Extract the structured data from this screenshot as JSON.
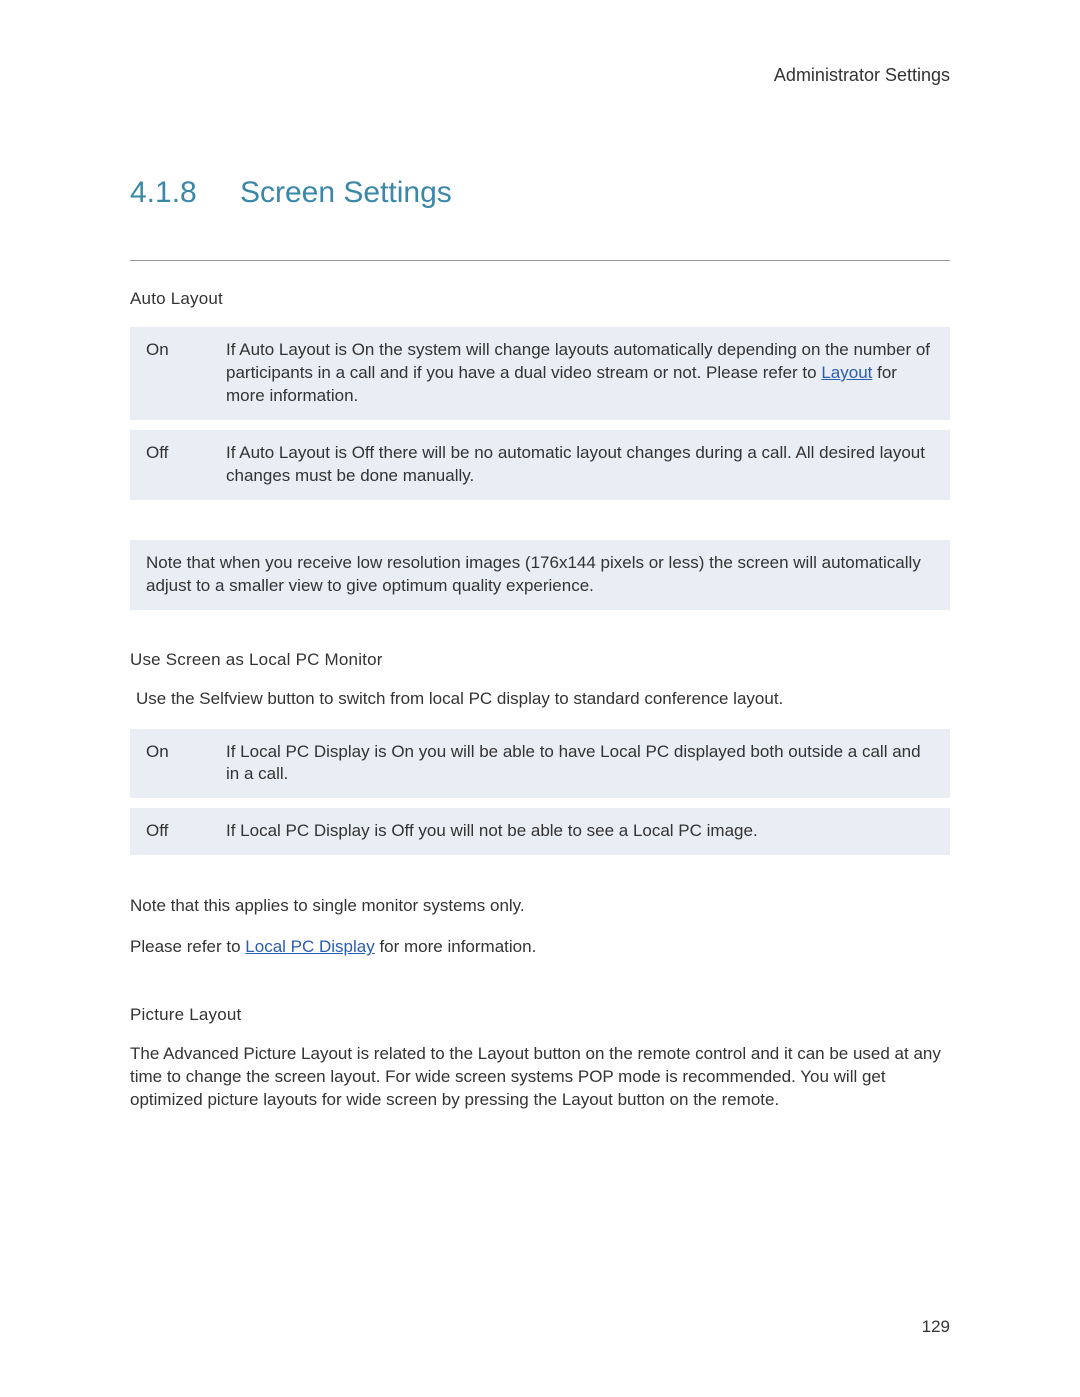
{
  "header": {
    "breadcrumb": "Administrator Settings"
  },
  "section": {
    "number": "4.1.8",
    "title": "Screen Settings"
  },
  "auto_layout": {
    "heading": "Auto Layout",
    "rows": [
      {
        "key": "On",
        "desc_before_link": "If Auto Layout is On the system will change layouts automatically depending on the number of participants in a call and if you have a dual video stream or not. Please refer to ",
        "link_text": "Layout",
        "desc_after_link": " for more information."
      },
      {
        "key": "Off",
        "desc": "If Auto Layout is Off there will be no automatic layout changes during a call. All desired layout changes must be done manually."
      }
    ],
    "note": "Note that when you receive low resolution images (176x144 pixels or less) the screen will automatically adjust to a smaller view to give optimum quality experience."
  },
  "local_pc": {
    "heading": "Use Screen as Local PC Monitor",
    "intro": "Use the Selfview button to switch from local PC display to standard conference layout.",
    "rows": [
      {
        "key": "On",
        "desc": "If Local PC Display is On you will be able to have Local PC displayed both outside a call and in a call."
      },
      {
        "key": "Off",
        "desc": "If Local PC Display is Off you will not be able to see a Local PC image."
      }
    ],
    "note1": "Note that this applies to single monitor systems only.",
    "note2_before_link": "Please refer to ",
    "note2_link_text": "Local PC Display",
    "note2_after_link": " for more information."
  },
  "picture_layout": {
    "heading": "Picture Layout",
    "body": "The Advanced Picture Layout is related to the Layout button on the remote control and it can be used at any time to change the screen layout. For wide screen systems POP mode is recommended. You will get optimized picture layouts for wide screen by pressing the Layout button on the remote."
  },
  "page_number": "129"
}
